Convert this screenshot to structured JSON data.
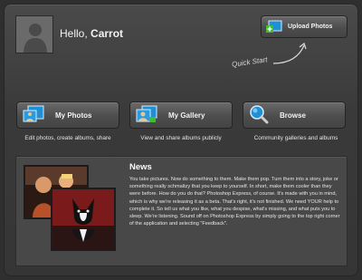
{
  "header": {
    "greeting": "Hello,",
    "user_name": "Carrot",
    "upload_label": "Upload Photos",
    "quick_start": "Quick Start"
  },
  "actions": [
    {
      "label": "My Photos",
      "caption": "Edit photos, create albums, share",
      "icon": "photos-icon"
    },
    {
      "label": "My Gallery",
      "caption": "View and share albums publicly",
      "icon": "gallery-icon"
    },
    {
      "label": "Browse",
      "caption": "Community galleries and albums",
      "icon": "magnifier-icon"
    }
  ],
  "news": {
    "title": "News",
    "body": "You take pictures. Now do something to them. Make them pop. Turn them into a story, joke or something really schmaltzy that you keep to yourself. In short, make them cooler than they were before. How do you do that? Photoshop Express, of course. It's made with you in mind, which is why we're releasing it as a beta. That's right, it's not finished. We need YOUR help to complete it. So tell us what you like, what you despise, what's missing, and what puts you to sleep. We're listening. Sound off on Photoshop Express by simply going to the top right corner of the application and selecting \"Feedback\"."
  },
  "colors": {
    "background": "#2f2f2f",
    "panel": "#3d3d3d",
    "accent_blue": "#1f8fd6",
    "accent_green": "#3fbf2f"
  }
}
